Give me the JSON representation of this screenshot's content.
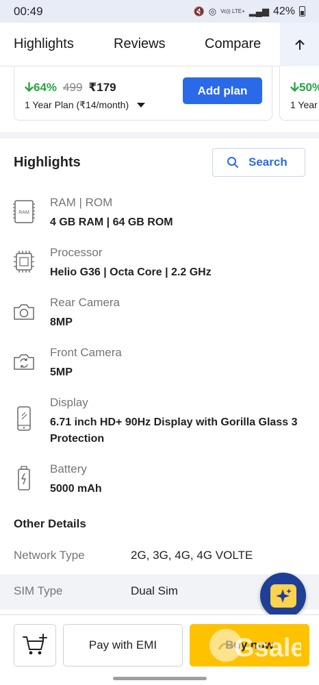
{
  "status_bar": {
    "time": "00:49",
    "network_label": "Vo)) LTE+",
    "battery": "42%"
  },
  "tabs": {
    "highlights": "Highlights",
    "reviews": "Reviews",
    "compare": "Compare"
  },
  "plan": {
    "discount": "64%",
    "mrp": "499",
    "price": "₹179",
    "term": "1 Year Plan (₹14/month)",
    "add_label": "Add plan",
    "next_discount": "50%",
    "next_term": "1 Year"
  },
  "highlights": {
    "title": "Highlights",
    "search_label": "Search",
    "specs": [
      {
        "label": "RAM | ROM",
        "value": "4 GB RAM | 64 GB ROM",
        "icon": "ram-chip-icon",
        "icon_text": "RAM"
      },
      {
        "label": "Processor",
        "value": "Helio G36 | Octa Core | 2.2 GHz",
        "icon": "processor-icon"
      },
      {
        "label": "Rear Camera",
        "value": "8MP",
        "icon": "camera-icon"
      },
      {
        "label": "Front Camera",
        "value": "5MP",
        "icon": "front-camera-icon"
      },
      {
        "label": "Display",
        "value": "6.71 inch HD+ 90Hz Display with Gorilla Glass 3 Protection",
        "icon": "phone-display-icon"
      },
      {
        "label": "Battery",
        "value": "5000 mAh",
        "icon": "battery-icon"
      }
    ]
  },
  "other_details": {
    "title": "Other Details",
    "rows": [
      {
        "key": "Network Type",
        "value": "2G, 3G, 4G, 4G VOLTE"
      },
      {
        "key": "SIM Type",
        "value": "Dual Sim"
      }
    ]
  },
  "bottom_bar": {
    "emi_label": "Pay with EMI",
    "buy_label": "Buy now"
  },
  "watermark": {
    "text": "Gsale"
  },
  "colors": {
    "accent": "#2a6ae9",
    "discount_green": "#26a541",
    "buy_yellow": "#ffc200",
    "fab_blue": "#1f3f96"
  }
}
